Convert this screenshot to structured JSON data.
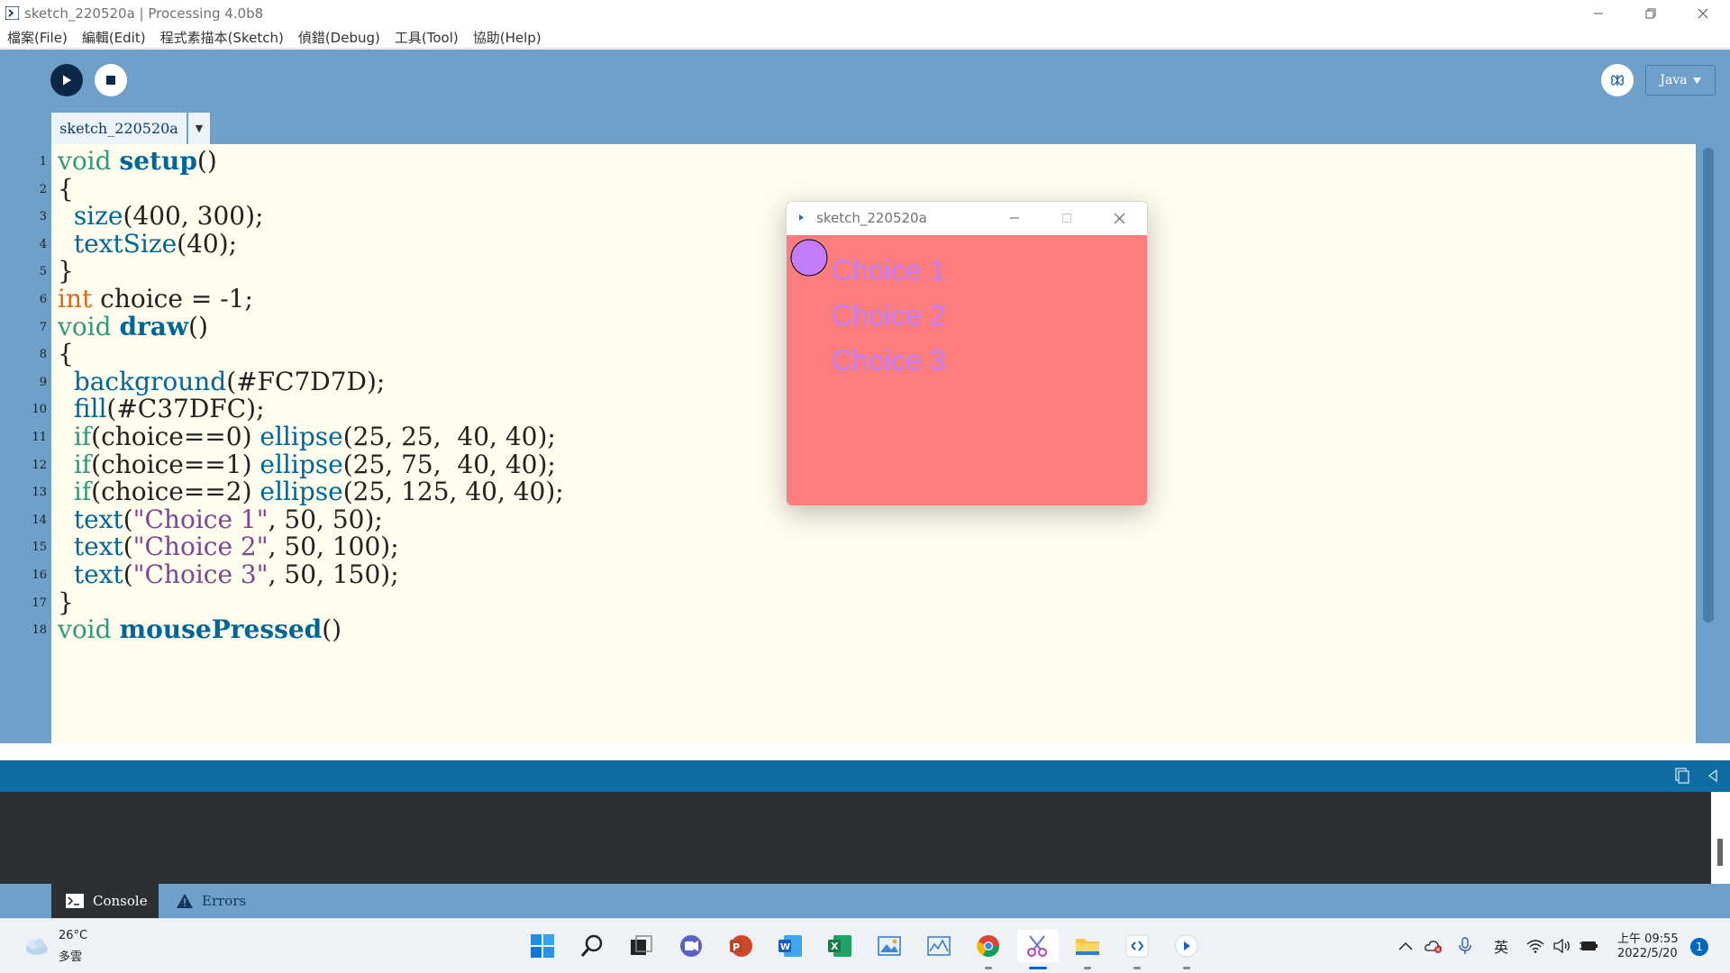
{
  "window": {
    "title": "sketch_220520a | Processing 4.0b8"
  },
  "menu": [
    {
      "label": "檔案(File)"
    },
    {
      "label": "編輯(Edit)"
    },
    {
      "label": "程式素描本(Sketch)"
    },
    {
      "label": "偵錯(Debug)"
    },
    {
      "label": "工具(Tool)"
    },
    {
      "label": "協助(Help)"
    }
  ],
  "toolbar": {
    "mode": "Java"
  },
  "tab": {
    "name": "sketch_220520a",
    "menu_glyph": "▼"
  },
  "code": {
    "line_numbers": [
      "1",
      "2",
      "3",
      "4",
      "5",
      "6",
      "7",
      "8",
      "9",
      "10",
      "11",
      "12",
      "13",
      "14",
      "15",
      "16",
      "17",
      "18"
    ],
    "lines": [
      [
        {
          "t": "void",
          "c": "kw-void"
        },
        {
          "t": " "
        },
        {
          "t": "setup",
          "c": "fn-def"
        },
        {
          "t": "()"
        }
      ],
      [
        {
          "t": "{"
        }
      ],
      [
        {
          "t": "  "
        },
        {
          "t": "size",
          "c": "fn-call"
        },
        {
          "t": "(400, 300);"
        }
      ],
      [
        {
          "t": "  "
        },
        {
          "t": "textSize",
          "c": "fn-call"
        },
        {
          "t": "(40);"
        }
      ],
      [
        {
          "t": "}"
        }
      ],
      [
        {
          "t": "int",
          "c": "kw-type"
        },
        {
          "t": " choice = -1;"
        }
      ],
      [
        {
          "t": "void",
          "c": "kw-void"
        },
        {
          "t": " "
        },
        {
          "t": "draw",
          "c": "fn-def"
        },
        {
          "t": "()"
        }
      ],
      [
        {
          "t": "{"
        }
      ],
      [
        {
          "t": "  "
        },
        {
          "t": "background",
          "c": "fn-call"
        },
        {
          "t": "(#FC7D7D);"
        }
      ],
      [
        {
          "t": "  "
        },
        {
          "t": "fill",
          "c": "fn-call"
        },
        {
          "t": "(#C37DFC);"
        }
      ],
      [
        {
          "t": "  "
        },
        {
          "t": "if",
          "c": "kw-void"
        },
        {
          "t": "(choice==0) "
        },
        {
          "t": "ellipse",
          "c": "fn-call"
        },
        {
          "t": "(25, 25,  40, 40);"
        }
      ],
      [
        {
          "t": "  "
        },
        {
          "t": "if",
          "c": "kw-void"
        },
        {
          "t": "(choice==1) "
        },
        {
          "t": "ellipse",
          "c": "fn-call"
        },
        {
          "t": "(25, 75,  40, 40);"
        }
      ],
      [
        {
          "t": "  "
        },
        {
          "t": "if",
          "c": "kw-void"
        },
        {
          "t": "(choice==2) "
        },
        {
          "t": "ellipse",
          "c": "fn-call"
        },
        {
          "t": "(25, 125, 40, 40);"
        }
      ],
      [
        {
          "t": "  "
        },
        {
          "t": "text",
          "c": "fn-call"
        },
        {
          "t": "("
        },
        {
          "t": "\"Choice 1\"",
          "c": "str"
        },
        {
          "t": ", 50, 50);"
        }
      ],
      [
        {
          "t": "  "
        },
        {
          "t": "text",
          "c": "fn-call"
        },
        {
          "t": "("
        },
        {
          "t": "\"Choice 2\"",
          "c": "str"
        },
        {
          "t": ", 50, 100);"
        }
      ],
      [
        {
          "t": "  "
        },
        {
          "t": "text",
          "c": "fn-call"
        },
        {
          "t": "("
        },
        {
          "t": "\"Choice 3\"",
          "c": "str"
        },
        {
          "t": ", 50, 150);"
        }
      ],
      [
        {
          "t": "}"
        }
      ],
      [
        {
          "t": "void",
          "c": "kw-void"
        },
        {
          "t": " "
        },
        {
          "t": "mousePressed",
          "c": "fn-def"
        },
        {
          "t": "()"
        }
      ]
    ]
  },
  "sketch_window": {
    "title": "sketch_220520a",
    "background": "#FC7D7D",
    "fill": "#C37DFC",
    "choices": [
      "Choice 1",
      "Choice 2",
      "Choice 3"
    ],
    "selected_choice": 0
  },
  "console_tabs": {
    "console": "Console",
    "errors": "Errors"
  },
  "taskbar": {
    "weather": {
      "temp": "26°C",
      "desc": "多雲"
    },
    "ime": "英",
    "clock": {
      "time": "上午 09:55",
      "date": "2022/5/20"
    },
    "notifications": "1"
  },
  "colors": {
    "toolbar_bg": "#6EA0C9",
    "editor_bg": "#FFFDEE",
    "status_bg": "#0F6CA3",
    "console_bg": "#2C3034"
  }
}
